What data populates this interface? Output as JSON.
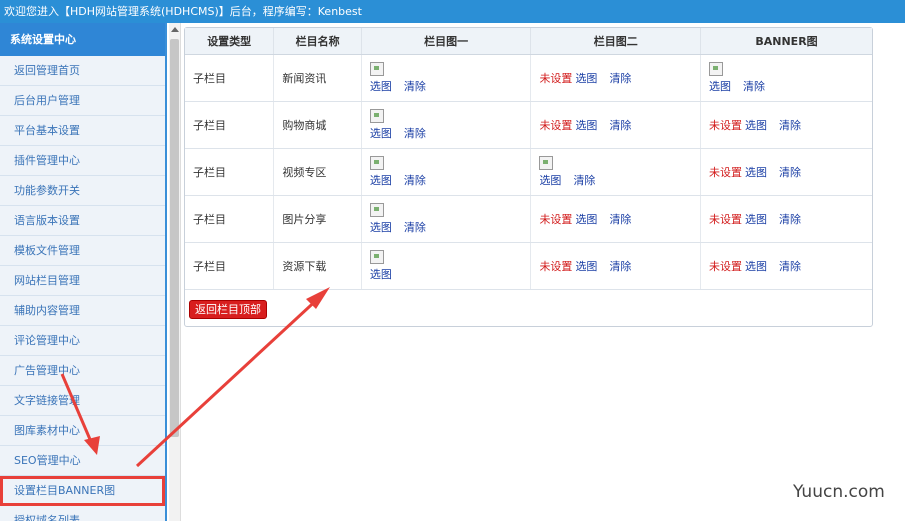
{
  "header": {
    "welcome": "欢迎您进入【HDH网站管理系统(HDHCMS)】后台，程序编写：Kenbest"
  },
  "sidebar": {
    "title": "系统设置中心",
    "items": [
      {
        "label": "返回管理首页"
      },
      {
        "label": "后台用户管理"
      },
      {
        "label": "平台基本设置"
      },
      {
        "label": "插件管理中心"
      },
      {
        "label": "功能参数开关"
      },
      {
        "label": "语言版本设置"
      },
      {
        "label": "模板文件管理"
      },
      {
        "label": "网站栏目管理"
      },
      {
        "label": "辅助内容管理"
      },
      {
        "label": "评论管理中心"
      },
      {
        "label": "广告管理中心"
      },
      {
        "label": "文字链接管理"
      },
      {
        "label": "图库素材中心"
      },
      {
        "label": "SEO管理中心"
      },
      {
        "label": "设置栏目BANNER图"
      },
      {
        "label": "授权域名列表"
      }
    ]
  },
  "table": {
    "headers": [
      "设置类型",
      "栏目名称",
      "栏目图一",
      "栏目图二",
      "BANNER图"
    ],
    "rows": [
      {
        "type": "子栏目",
        "name": "新闻资讯",
        "img1": "set",
        "img2": "unset",
        "banner": "set"
      },
      {
        "type": "子栏目",
        "name": "购物商城",
        "img1": "set",
        "img2": "unset",
        "banner": "unset"
      },
      {
        "type": "子栏目",
        "name": "视频专区",
        "img1": "set",
        "img2": "set",
        "banner": "unset"
      },
      {
        "type": "子栏目",
        "name": "图片分享",
        "img1": "set",
        "img2": "unset",
        "banner": "unset"
      },
      {
        "type": "子栏目",
        "name": "资源下载",
        "img1": "set-noclear",
        "img2": "unset",
        "banner": "unset"
      }
    ]
  },
  "labels": {
    "select": "选图",
    "clear": "清除",
    "unset": "未设置",
    "back_button": "返回栏目顶部"
  },
  "watermark": "Yuucn.com",
  "colors": {
    "topbar": "#2b8fd6",
    "sidebar_title": "#2f86d6",
    "unset_text": "#d21b1b",
    "link_text": "#1b3fa5",
    "annotation": "#e8403a"
  }
}
